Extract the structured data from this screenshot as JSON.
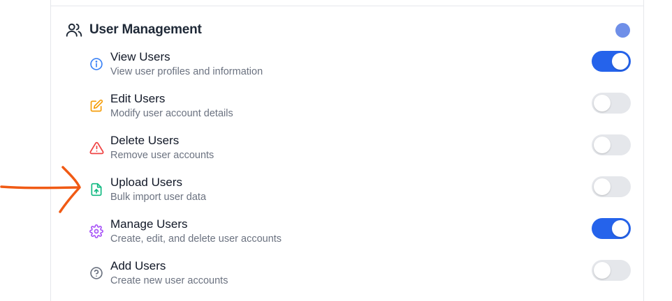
{
  "section": {
    "title": "User Management",
    "icon": "users-icon",
    "status_color": "#6f8fe8"
  },
  "permissions": [
    {
      "title": "View Users",
      "description": "View user profiles and information",
      "icon": "info-icon",
      "icon_color": "#3b82f6",
      "enabled": true
    },
    {
      "title": "Edit Users",
      "description": "Modify user account details",
      "icon": "edit-icon",
      "icon_color": "#f59e0b",
      "enabled": false
    },
    {
      "title": "Delete Users",
      "description": "Remove user accounts",
      "icon": "warning-icon",
      "icon_color": "#ef4444",
      "enabled": false
    },
    {
      "title": "Upload Users",
      "description": "Bulk import user data",
      "icon": "file-upload-icon",
      "icon_color": "#10b981",
      "enabled": false
    },
    {
      "title": "Manage Users",
      "description": "Create, edit, and delete user accounts",
      "icon": "gear-icon",
      "icon_color": "#a855f7",
      "enabled": true
    },
    {
      "title": "Add Users",
      "description": "Create new user accounts",
      "icon": "help-circle-icon",
      "icon_color": "#6b7280",
      "enabled": false
    }
  ],
  "annotation": {
    "color": "#f05a14"
  },
  "colors": {
    "toggle_on": "#2563eb",
    "toggle_off": "#e5e7eb"
  }
}
